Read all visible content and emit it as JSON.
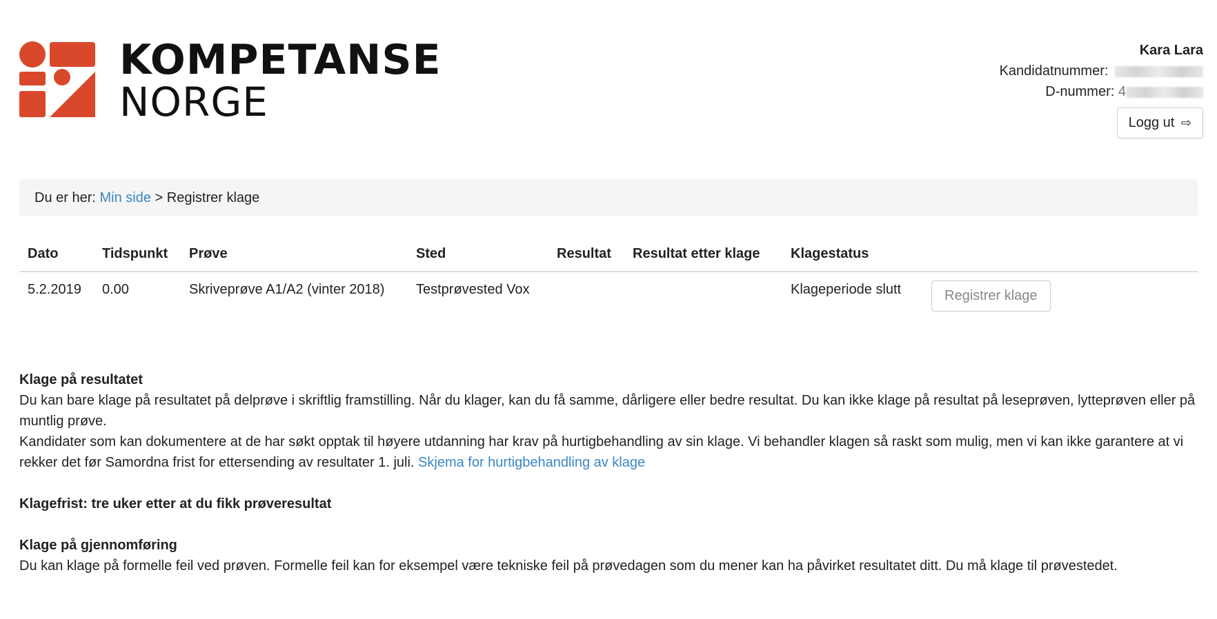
{
  "brand": {
    "line1": "KOMPETANSE",
    "line2": "NORGE",
    "color": "#d9482b"
  },
  "user": {
    "name": "Kara Lara",
    "kandidat_label": "Kandidatnummer:",
    "dnummer_label": "D-nummer:",
    "dnummer_visible_prefix": "4",
    "logout_label": "Logg ut",
    "logout_icon": "sign-out-icon"
  },
  "breadcrumb": {
    "prefix": "Du er her:",
    "link": "Min side",
    "separator": ">",
    "current": "Registrer klage"
  },
  "table": {
    "headers": [
      "Dato",
      "Tidspunkt",
      "Prøve",
      "Sted",
      "Resultat",
      "Resultat etter klage",
      "Klagestatus",
      ""
    ],
    "rows": [
      {
        "dato": "5.2.2019",
        "tidspunkt": "0.00",
        "prove": "Skriveprøve A1/A2 (vinter 2018)",
        "sted": "Testprøvested Vox",
        "resultat": "",
        "resultat_etter_klage": "",
        "klagestatus": "Klageperiode slutt",
        "action_label": "Registrer klage"
      }
    ]
  },
  "info": {
    "section1_title": "Klage på resultatet",
    "section1_p1": "Du kan bare klage på resultatet på delprøve i skriftlig framstilling. Når du klager, kan du få samme, dårligere eller bedre resultat. Du kan ikke klage på resultat på leseprøven, lytteprøven eller på muntlig prøve.",
    "section1_p2": "Kandidater som kan dokumentere at de har søkt opptak til høyere utdanning har krav på hurtigbehandling av sin klage. Vi behandler klagen så raskt som mulig, men vi kan ikke garantere at vi rekker det før Samordna frist for ettersending av resultater 1. juli.",
    "section1_link": "Skjema for hurtigbehandling av klage",
    "deadline": "Klagefrist: tre uker etter at du fikk prøveresultat",
    "section2_title": "Klage på gjennomføring",
    "section2_p1": "Du kan klage på formelle feil ved prøven. Formelle feil kan for eksempel være tekniske feil på prøvedagen som du mener kan ha påvirket resultatet ditt. Du må klage til prøvestedet."
  }
}
